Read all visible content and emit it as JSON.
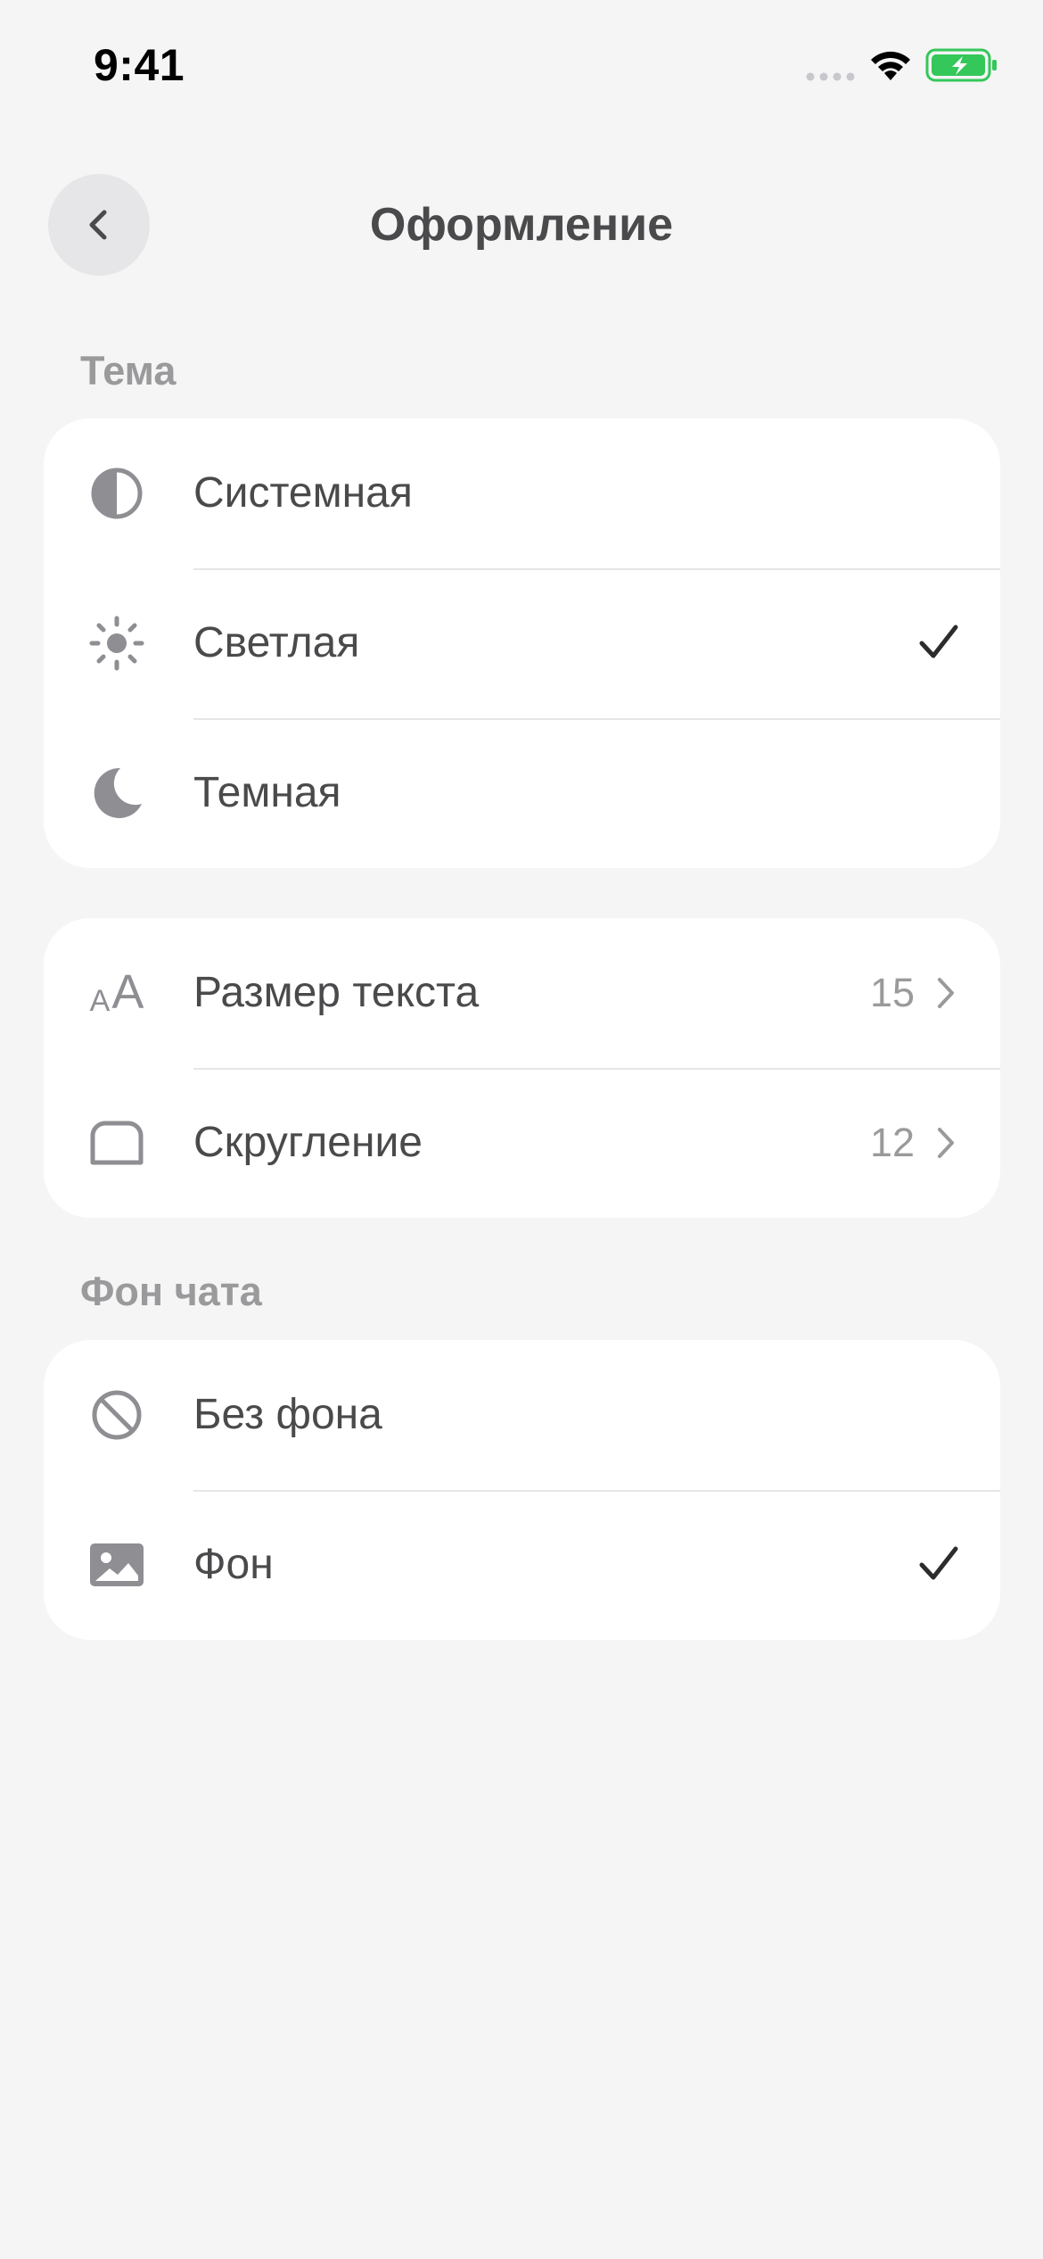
{
  "status_bar": {
    "time": "9:41"
  },
  "header": {
    "title": "Оформление"
  },
  "theme_section": {
    "label": "Тема",
    "items": [
      {
        "label": "Системная",
        "icon": "half-circle-icon",
        "selected": false
      },
      {
        "label": "Светлая",
        "icon": "sun-icon",
        "selected": true
      },
      {
        "label": "Темная",
        "icon": "moon-icon",
        "selected": false
      }
    ]
  },
  "display_section": {
    "items": [
      {
        "label": "Размер текста",
        "icon": "text-size-icon",
        "value": "15"
      },
      {
        "label": "Скругление",
        "icon": "rounded-rect-icon",
        "value": "12"
      }
    ]
  },
  "chat_background_section": {
    "label": "Фон чата",
    "items": [
      {
        "label": "Без фона",
        "icon": "prohibited-icon",
        "selected": false
      },
      {
        "label": "Фон",
        "icon": "image-icon",
        "selected": true
      }
    ]
  },
  "colors": {
    "background": "#f5f5f5",
    "card": "#ffffff",
    "text": "#4a4a4c",
    "secondary_text": "#9a9a9c",
    "icon": "#8e8e93",
    "battery": "#34c759"
  }
}
